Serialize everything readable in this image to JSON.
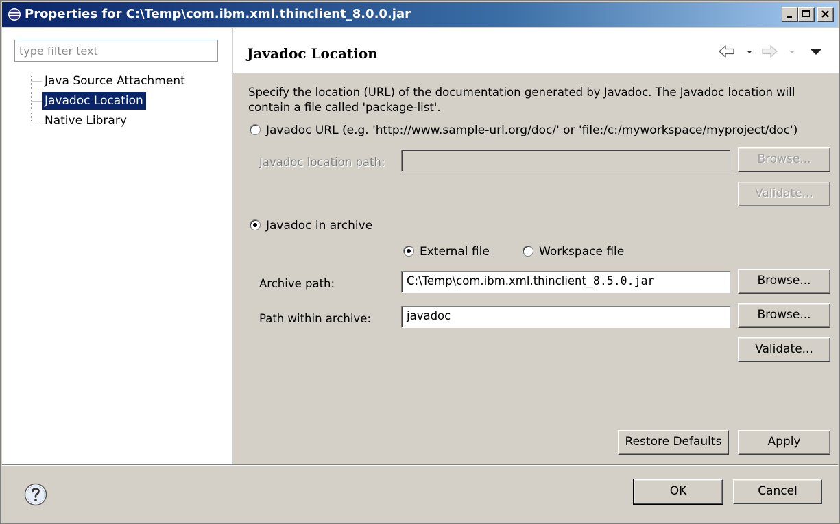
{
  "window": {
    "title": "Properties for C:\\Temp\\com.ibm.xml.thinclient_8.0.0.jar",
    "icons": [
      "eclipse-icon",
      "minimize-icon",
      "maximize-icon",
      "close-icon"
    ]
  },
  "sidebar": {
    "filter_placeholder": "type filter text",
    "items": [
      {
        "label": "Java Source Attachment",
        "selected": false
      },
      {
        "label": "Javadoc Location",
        "selected": true
      },
      {
        "label": "Native Library",
        "selected": false
      }
    ]
  },
  "page": {
    "title": "Javadoc Location",
    "nav_icons": [
      "back-arrow-icon",
      "dropdown-icon",
      "forward-arrow-icon",
      "view-menu-icon"
    ],
    "description": "Specify the location (URL) of the documentation generated by Javadoc. The Javadoc location will contain a file called 'package-list'.",
    "url_option": {
      "label": "Javadoc URL (e.g. 'http://www.sample-url.org/doc/' or 'file:/c:/myworkspace/myproject/doc')",
      "checked": false,
      "path_label": "Javadoc location path:",
      "path_value": "",
      "browse_label": "Browse...",
      "validate_label": "Validate..."
    },
    "archive_option": {
      "label": "Javadoc in archive",
      "checked": true,
      "external_label": "External file",
      "workspace_label": "Workspace file",
      "external_checked": true,
      "archive_path_label": "Archive path:",
      "archive_path_prefix": "C:\\Temp\\com.ibm.xml.thinclient",
      "archive_path_suffix": "_8.5.0.jar",
      "browse_archive_label": "Browse...",
      "path_within_label": "Path within archive:",
      "path_within_value": "javadoc",
      "browse_within_label": "Browse...",
      "validate_label": "Validate..."
    },
    "restore_defaults_label": "Restore Defaults",
    "apply_label": "Apply"
  },
  "footer": {
    "help_icon": "help-icon",
    "ok_label": "OK",
    "cancel_label": "Cancel"
  }
}
